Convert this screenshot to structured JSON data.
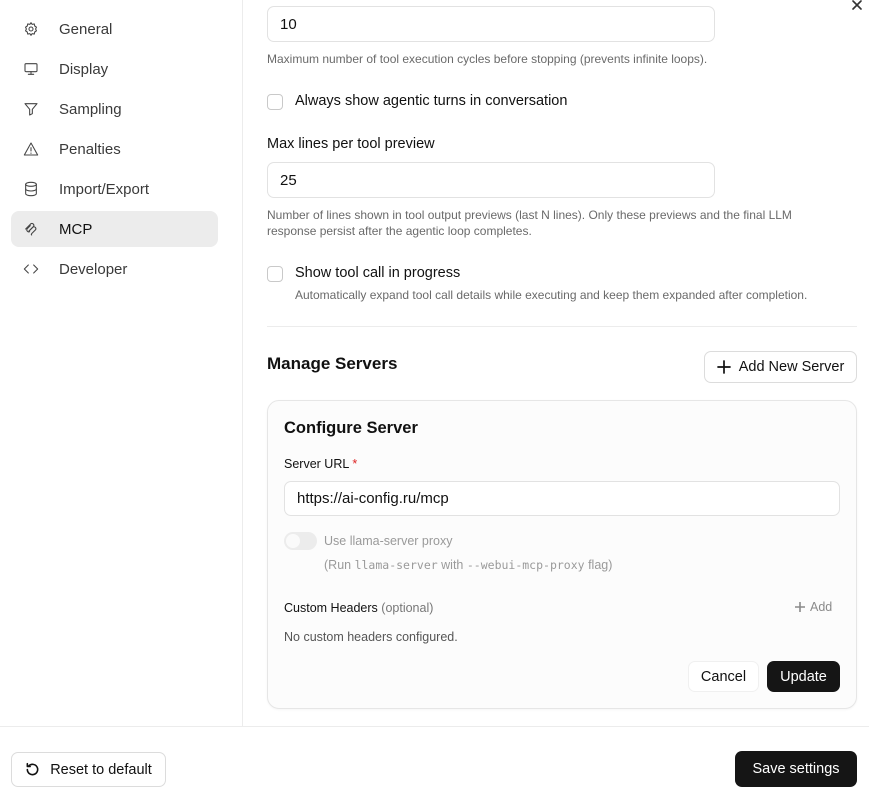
{
  "sidebar": {
    "items": [
      {
        "label": "General",
        "icon": "gear-icon"
      },
      {
        "label": "Display",
        "icon": "monitor-icon"
      },
      {
        "label": "Sampling",
        "icon": "funnel-icon"
      },
      {
        "label": "Penalties",
        "icon": "warning-triangle-icon"
      },
      {
        "label": "Import/Export",
        "icon": "database-icon"
      },
      {
        "label": "MCP",
        "icon": "mcp-icon",
        "active": true
      },
      {
        "label": "Developer",
        "icon": "code-icon"
      }
    ]
  },
  "settings": {
    "max_cycles_value": "10",
    "max_cycles_help": "Maximum number of tool execution cycles before stopping (prevents infinite loops).",
    "always_show_turns_label": "Always show agentic turns in conversation",
    "max_lines_label": "Max lines per tool preview",
    "max_lines_value": "25",
    "max_lines_help_1": "Number of lines shown in tool output previews (last N lines). Only these previews and the final LLM",
    "max_lines_help_2": "response persist after the agentic loop completes.",
    "show_tool_call_label": "Show tool call in progress",
    "show_tool_call_help": "Automatically expand tool call details while executing and keep them expanded after completion."
  },
  "servers": {
    "title": "Manage Servers",
    "add_button": "Add New Server",
    "card": {
      "title": "Configure Server",
      "url_label": "Server URL",
      "required_mark": "*",
      "url_value": "https://ai-config.ru/mcp",
      "proxy_label": "Use llama-server proxy",
      "proxy_hint_open": "(Run",
      "proxy_hint_cmd": "llama-server",
      "proxy_hint_with": "with",
      "proxy_hint_flag": "--webui-mcp-proxy",
      "proxy_hint_close": "flag)",
      "headers_label": "Custom Headers",
      "headers_optional": "(optional)",
      "headers_add": "Add",
      "headers_empty": "No custom headers configured.",
      "cancel": "Cancel",
      "update": "Update"
    }
  },
  "footer": {
    "reset": "Reset to default",
    "save": "Save settings"
  }
}
